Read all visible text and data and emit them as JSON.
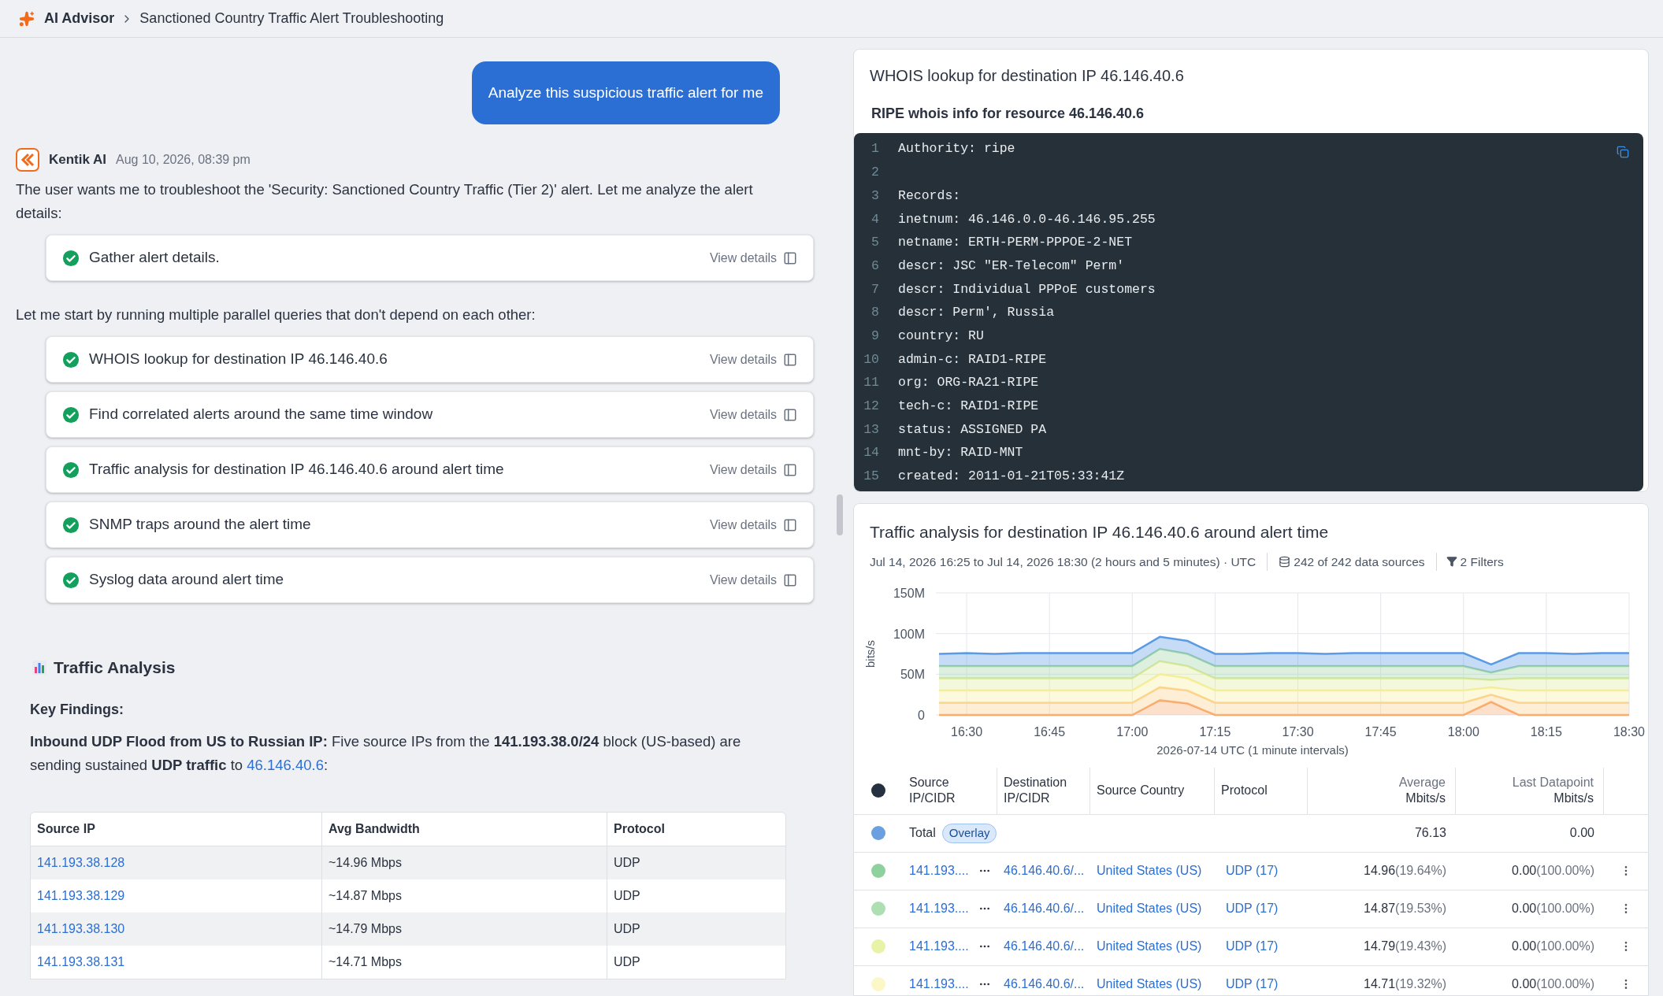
{
  "breadcrumb": {
    "root": "AI Advisor",
    "current": "Sanctioned Country Traffic Alert Troubleshooting"
  },
  "user_message": "Analyze this suspicious traffic alert for me",
  "assistant": {
    "name": "Kentik AI",
    "time": "Aug 10, 2026, 08:39 pm",
    "intro": "The user wants me to troubleshoot the 'Security: Sanctioned Country Traffic (Tier 2)' alert. Let me analyze the alert details:",
    "first_tasks": [
      {
        "label": "Gather alert details.",
        "done": true,
        "action": "View details"
      }
    ],
    "middle": "Let me start by running multiple parallel queries that don't depend on each other:",
    "tasks": [
      {
        "label": "WHOIS lookup for destination IP 46.146.40.6",
        "done": true,
        "action": "View details"
      },
      {
        "label": "Find correlated alerts around the same time window",
        "done": true,
        "action": "View details"
      },
      {
        "label": "Traffic analysis for destination IP 46.146.40.6 around alert time",
        "done": true,
        "action": "View details"
      },
      {
        "label": "SNMP traps around the alert time",
        "done": true,
        "action": "View details"
      },
      {
        "label": "Syslog data around alert time",
        "done": true,
        "action": "View details"
      }
    ],
    "section_title": "Traffic Analysis",
    "findings_title": "Key Findings:",
    "finding": {
      "text": "**Inbound UDP Flood from US to Russian IP:** Five source IPs from the **141.193.38.0/24** block (US-based) are sending sustained **UDP traffic** to",
      "link": "46.146.40.6",
      "after": ":"
    },
    "table": {
      "columns": [
        "Source IP",
        "Avg Bandwidth",
        "Protocol"
      ],
      "rows": [
        [
          "141.193.38.128",
          "~14.96 Mbps",
          "UDP"
        ],
        [
          "141.193.38.129",
          "~14.87 Mbps",
          "UDP"
        ],
        [
          "141.193.38.130",
          "~14.79 Mbps",
          "UDP"
        ],
        [
          "141.193.38.131",
          "~14.71 Mbps",
          "UDP"
        ]
      ]
    }
  },
  "whois": {
    "title": "WHOIS lookup for destination IP 46.146.40.6",
    "subtitle": "RIPE whois info for resource 46.146.40.6",
    "code_lines": [
      {
        "number": "1",
        "text": "Authority: ripe"
      },
      {
        "number": "2"
      },
      {
        "number": "3",
        "text": "Records:"
      },
      {
        "number": "4",
        "text": "inetnum: 46.146.0.0-46.146.95.255"
      },
      {
        "number": "5",
        "text": "netname: ERTH-PERM-PPPOE-2-NET"
      },
      {
        "number": "6",
        "text": "descr: JSC \"ER-Telecom\" Perm'"
      },
      {
        "number": "7",
        "text": "descr: Individual PPPoE customers"
      },
      {
        "number": "8",
        "text": "descr: Perm', Russia"
      },
      {
        "number": "9",
        "text": "country: RU"
      },
      {
        "number": "10",
        "text": "admin-c: RAID1-RIPE"
      },
      {
        "number": "11",
        "text": "org: ORG-RA21-RIPE"
      },
      {
        "number": "12",
        "text": "tech-c: RAID1-RIPE"
      },
      {
        "number": "13",
        "text": "status: ASSIGNED PA"
      },
      {
        "number": "14",
        "text": "mnt-by: RAID-MNT"
      },
      {
        "number": "15",
        "text": "created: 2011-01-21T05:33:41Z"
      }
    ]
  },
  "traffic": {
    "title": "Traffic analysis for destination IP 46.146.40.6 around alert time",
    "range": "Jul 14, 2026 16:25 to Jul 14, 2026 18:30 (2 hours and 5 minutes) · UTC",
    "sources": "242 of 242 data sources",
    "filters": "2 Filters",
    "chart_data": {
      "type": "area",
      "stacked": true,
      "ylabel": "bits/s",
      "xlabel": "2026-07-14 UTC (1 minute intervals)",
      "categories": [
        null,
        "16:30",
        null,
        null,
        "16:45",
        null,
        null,
        "17:00",
        null,
        null,
        "17:15",
        null,
        null,
        "17:30",
        null,
        null,
        "17:45",
        null,
        null,
        "18:00",
        null,
        null,
        "18:15",
        null,
        null,
        "18:30"
      ],
      "ylim": [
        0,
        150
      ],
      "grid": true,
      "yticks": [
        {
          "value": 0,
          "label": "0"
        },
        {
          "value": 50,
          "label": "50M"
        },
        {
          "value": 100,
          "label": "100M"
        },
        {
          "value": 150,
          "label": "150M"
        }
      ],
      "series": [
        {
          "color": "#f9a66a",
          "values": [
            0,
            0,
            0,
            0,
            0,
            0,
            0,
            0,
            18,
            14,
            0,
            0,
            0,
            0,
            0,
            0,
            0,
            0,
            0,
            0,
            16,
            0,
            0,
            0,
            0,
            0
          ]
        },
        {
          "color": "#fccf8a",
          "values": [
            15,
            15,
            15,
            15,
            15,
            15,
            15,
            15,
            16,
            16,
            15,
            15,
            15,
            15,
            15,
            15,
            15,
            15,
            15,
            15,
            9,
            15,
            15,
            15,
            15,
            15
          ]
        },
        {
          "color": "#f9ef9a",
          "values": [
            15,
            15,
            15,
            15,
            15,
            15,
            15,
            15,
            16,
            15,
            15,
            15,
            15,
            15,
            15,
            15,
            15,
            15,
            15,
            15,
            9,
            15,
            15,
            15,
            15,
            15
          ]
        },
        {
          "color": "#dcea9a",
          "values": [
            15,
            15,
            15,
            15,
            15,
            15,
            15,
            15,
            16,
            15,
            15,
            15,
            15,
            15,
            15,
            15,
            15,
            15,
            15,
            15,
            9,
            15,
            15,
            15,
            15,
            15
          ]
        },
        {
          "color": "#9fd4a6",
          "values": [
            15,
            15,
            15,
            15,
            15,
            15,
            15,
            15,
            15,
            15,
            15,
            15,
            15,
            15,
            15,
            15,
            15,
            15,
            15,
            15,
            9,
            15,
            15,
            15,
            15,
            15
          ]
        },
        {
          "color": "#5b9be6",
          "values": [
            15,
            16,
            15,
            16,
            16,
            16,
            16,
            16,
            15,
            16,
            15,
            15,
            16,
            16,
            15,
            16,
            16,
            16,
            16,
            16,
            10,
            16,
            16,
            15,
            16,
            16
          ]
        }
      ]
    },
    "table": {
      "columns": [
        {
          "label": "Source IP/CIDR"
        },
        {
          "label": "Destination IP/CIDR"
        },
        {
          "label": "Source Country"
        },
        {
          "label": "Protocol"
        },
        {
          "label": "Average",
          "unit": "Mbits/s"
        },
        {
          "label": "Last Datapoint",
          "unit": "Mbits/s"
        }
      ],
      "total": {
        "label": "Total",
        "badge": "Overlay",
        "color": "#6a9fe0",
        "average": "76.13",
        "last": "0.00"
      },
      "rows": [
        {
          "color": "#8fd19e",
          "source": "141.193....",
          "destination": "46.146.40.6/...",
          "country": "United States (US)",
          "protocol": "UDP (17)",
          "average": "14.96",
          "average_pct": "(19.64%)",
          "last": "0.00",
          "last_pct": "(100.00%)"
        },
        {
          "color": "#addfb3",
          "source": "141.193....",
          "destination": "46.146.40.6/...",
          "country": "United States (US)",
          "protocol": "UDP (17)",
          "average": "14.87",
          "average_pct": "(19.53%)",
          "last": "0.00",
          "last_pct": "(100.00%)"
        },
        {
          "color": "#e8f3a8",
          "source": "141.193....",
          "destination": "46.146.40.6/...",
          "country": "United States (US)",
          "protocol": "UDP (17)",
          "average": "14.79",
          "average_pct": "(19.43%)",
          "last": "0.00",
          "last_pct": "(100.00%)"
        },
        {
          "color": "#fbf7c6",
          "source": "141.193....",
          "destination": "46.146.40.6/...",
          "country": "United States (US)",
          "protocol": "UDP (17)",
          "average": "14.71",
          "average_pct": "(19.32%)",
          "last": "0.00",
          "last_pct": "(100.00%)"
        }
      ]
    }
  }
}
